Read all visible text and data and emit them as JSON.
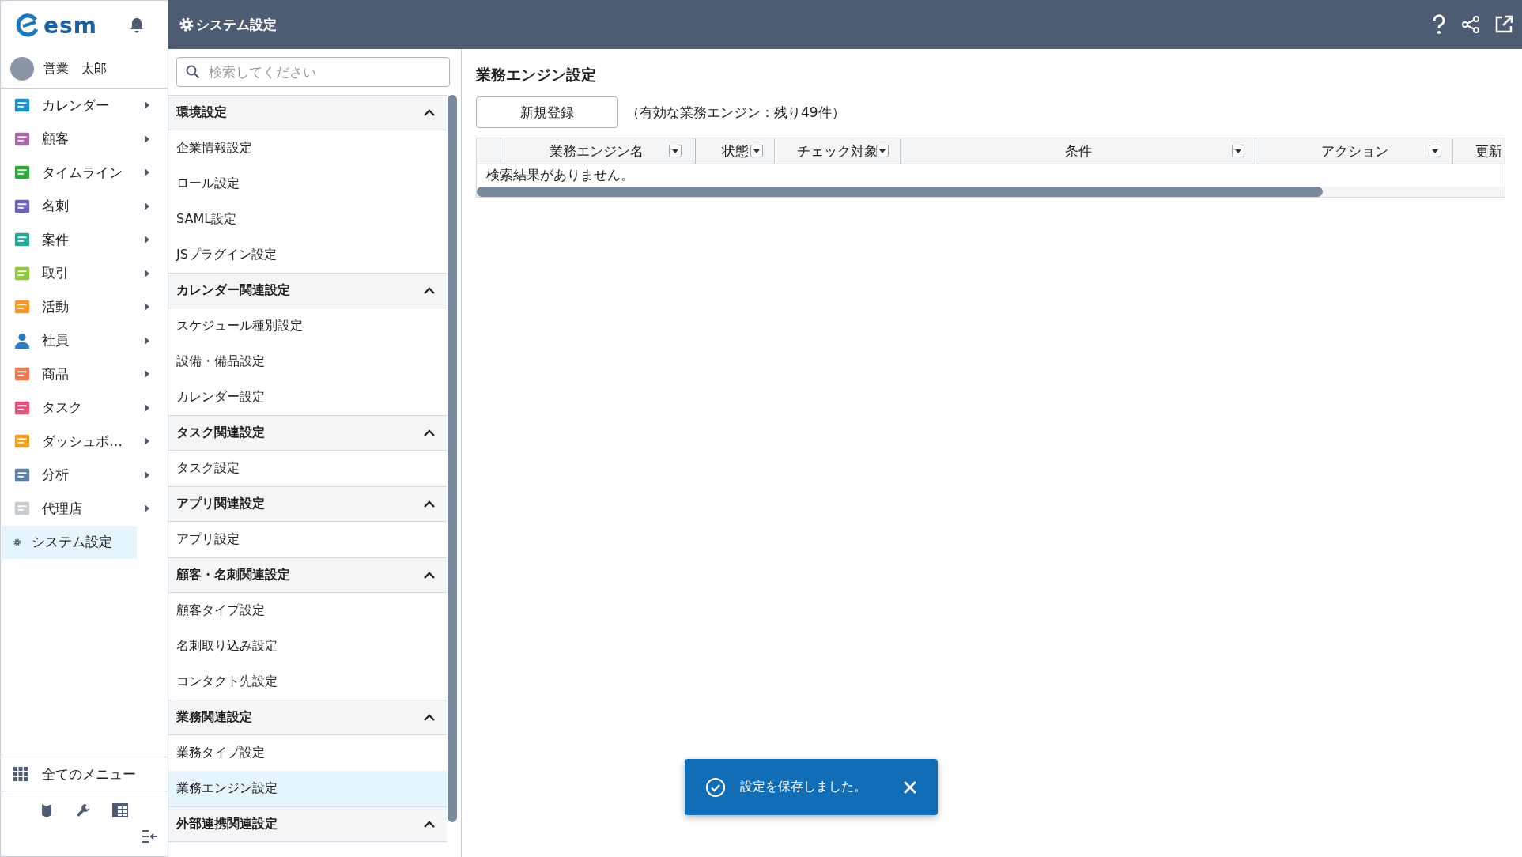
{
  "sidebar": {
    "logo_text": "esm",
    "user": {
      "name": "営業　太郎"
    },
    "items": [
      {
        "label": "カレンダー",
        "selected": false
      },
      {
        "label": "顧客",
        "selected": false
      },
      {
        "label": "タイムライン",
        "selected": false
      },
      {
        "label": "名刺",
        "selected": false
      },
      {
        "label": "案件",
        "selected": false
      },
      {
        "label": "取引",
        "selected": false
      },
      {
        "label": "活動",
        "selected": false
      },
      {
        "label": "社員",
        "selected": false
      },
      {
        "label": "商品",
        "selected": false
      },
      {
        "label": "タスク",
        "selected": false
      },
      {
        "label": "ダッシュボ…",
        "selected": false
      },
      {
        "label": "分析",
        "selected": false
      },
      {
        "label": "代理店",
        "selected": false
      },
      {
        "label": "システム設定",
        "selected": true
      }
    ],
    "all_menu": "全てのメニュー"
  },
  "header": {
    "title": "システム設定"
  },
  "settings_nav": {
    "search": {
      "placeholder": "検索してください"
    },
    "groups": [
      {
        "title": "環境設定",
        "expanded": true,
        "items": [
          {
            "label": "企業情報設定",
            "selected": false
          },
          {
            "label": "ロール設定",
            "selected": false
          },
          {
            "label": "SAML設定",
            "selected": false
          },
          {
            "label": "JSプラグイン設定",
            "selected": false
          }
        ]
      },
      {
        "title": "カレンダー関連設定",
        "expanded": true,
        "items": [
          {
            "label": "スケジュール種別設定",
            "selected": false
          },
          {
            "label": "設備・備品設定",
            "selected": false
          },
          {
            "label": "カレンダー設定",
            "selected": false
          }
        ]
      },
      {
        "title": "タスク関連設定",
        "expanded": true,
        "items": [
          {
            "label": "タスク設定",
            "selected": false
          }
        ]
      },
      {
        "title": "アプリ関連設定",
        "expanded": true,
        "items": [
          {
            "label": "アプリ設定",
            "selected": false
          }
        ]
      },
      {
        "title": "顧客・名刺関連設定",
        "expanded": true,
        "items": [
          {
            "label": "顧客タイプ設定",
            "selected": false
          },
          {
            "label": "名刺取り込み設定",
            "selected": false
          },
          {
            "label": "コンタクト先設定",
            "selected": false
          }
        ]
      },
      {
        "title": "業務関連設定",
        "expanded": true,
        "items": [
          {
            "label": "業務タイプ設定",
            "selected": false
          },
          {
            "label": "業務エンジン設定",
            "selected": true
          }
        ]
      },
      {
        "title": "外部連携関連設定",
        "expanded": true
      }
    ]
  },
  "main": {
    "title": "業務エンジン設定",
    "new_button": "新規登録",
    "remaining_note": "（有効な業務エンジン：残り49件）",
    "table": {
      "columns": [
        {
          "label": "業務エンジン名",
          "filter": true
        },
        {
          "label": "状態",
          "filter": true
        },
        {
          "label": "チェック対象",
          "filter": true
        },
        {
          "label": "条件",
          "filter": true
        },
        {
          "label": "アクション",
          "filter": true
        },
        {
          "label": "更新",
          "filter": false
        }
      ],
      "empty_message": "検索結果がありません。"
    }
  },
  "toast": {
    "message": "設定を保存しました。"
  }
}
